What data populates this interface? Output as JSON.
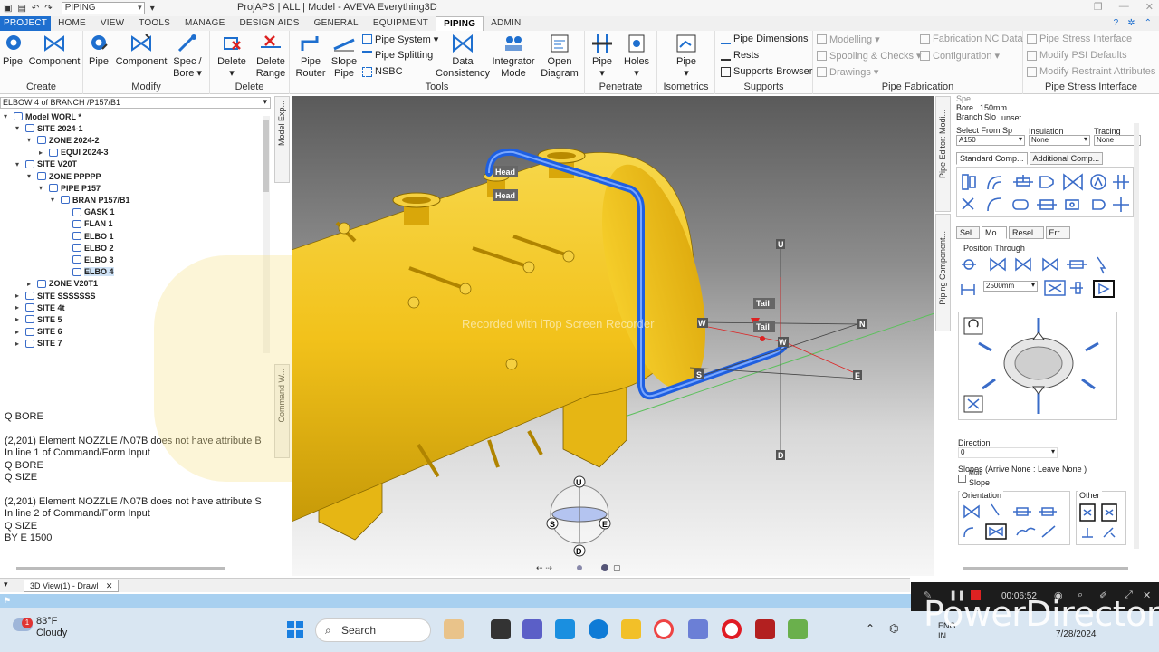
{
  "titlebar": {
    "module_combo": "PIPING",
    "title": "ProjAPS | ALL | Model - AVEVA Everything3D"
  },
  "menu": {
    "tabs": [
      "PROJECT",
      "HOME",
      "VIEW",
      "TOOLS",
      "MANAGE",
      "DESIGN AIDS",
      "GENERAL",
      "EQUIPMENT",
      "PIPING",
      "ADMIN"
    ]
  },
  "ribbon": {
    "create": {
      "title": "Create",
      "pipe": "Pipe",
      "component": "Component"
    },
    "modify": {
      "title": "Modify",
      "pipe": "Pipe",
      "component": "Component",
      "spec": "Spec /",
      "bore": "Bore"
    },
    "delete": {
      "title": "Delete",
      "delete": "Delete",
      "delete_range_1": "Delete",
      "delete_range_2": "Range"
    },
    "tools": {
      "title": "Tools",
      "pipe_router_1": "Pipe",
      "pipe_router_2": "Router",
      "slope_1": "Slope",
      "slope_2": "Pipe",
      "pipe_system": "Pipe System",
      "pipe_splitting": "Pipe Splitting",
      "nsbc": "NSBC",
      "data_1": "Data",
      "data_2": "Consistency",
      "integrator_1": "Integrator",
      "integrator_2": "Mode",
      "open_1": "Open",
      "open_2": "Diagram"
    },
    "penetrate": {
      "title": "Penetrate",
      "pipe": "Pipe",
      "holes": "Holes"
    },
    "isometrics": {
      "title": "Isometrics",
      "pipe": "Pipe"
    },
    "supports": {
      "title": "Supports",
      "pipe_dimensions": "Pipe Dimensions",
      "rests": "Rests",
      "supports_browser": "Supports Browser"
    },
    "pipe_fabrication": {
      "title": "Pipe Fabrication",
      "modelling": "Modelling",
      "spooling": "Spooling & Checks",
      "drawings": "Drawings",
      "fab_nc": "Fabrication NC Data",
      "configuration": "Configuration"
    },
    "stress": {
      "title": "Pipe Stress Interface",
      "psi": "Pipe Stress Interface",
      "modify_psi": "Modify PSI Defaults",
      "modify_restraint": "Modify Restraint Attributes"
    }
  },
  "explorer": {
    "current": "ELBOW 4 of BRANCH /P157/B1",
    "tab_label": "Model Exp...",
    "tree": [
      {
        "label": "Model WORL *",
        "indent": 0,
        "exp": "▾",
        "sel": false
      },
      {
        "label": "SITE 2024-1",
        "indent": 1,
        "exp": "▾",
        "sel": false
      },
      {
        "label": "ZONE 2024-2",
        "indent": 2,
        "exp": "▾",
        "sel": false
      },
      {
        "label": "EQUI 2024-3",
        "indent": 3,
        "exp": "▸",
        "sel": false
      },
      {
        "label": "SITE V20T",
        "indent": 1,
        "exp": "▾",
        "sel": false
      },
      {
        "label": "ZONE PPPPP",
        "indent": 2,
        "exp": "▾",
        "sel": false
      },
      {
        "label": "PIPE P157",
        "indent": 3,
        "exp": "▾",
        "sel": false
      },
      {
        "label": "BRAN P157/B1",
        "indent": 4,
        "exp": "▾",
        "sel": false
      },
      {
        "label": "GASK 1",
        "indent": 5,
        "exp": "",
        "sel": false
      },
      {
        "label": "FLAN 1",
        "indent": 5,
        "exp": "",
        "sel": false
      },
      {
        "label": "ELBO 1",
        "indent": 5,
        "exp": "",
        "sel": false
      },
      {
        "label": "ELBO 2",
        "indent": 5,
        "exp": "",
        "sel": false
      },
      {
        "label": "ELBO 3",
        "indent": 5,
        "exp": "",
        "sel": false
      },
      {
        "label": "ELBO 4",
        "indent": 5,
        "exp": "",
        "sel": true
      },
      {
        "label": "ZONE V20T1",
        "indent": 2,
        "exp": "▸",
        "sel": false
      },
      {
        "label": "SITE SSSSSSS",
        "indent": 1,
        "exp": "▸",
        "sel": false
      },
      {
        "label": "SITE 4t",
        "indent": 1,
        "exp": "▸",
        "sel": false
      },
      {
        "label": "SITE 5",
        "indent": 1,
        "exp": "▸",
        "sel": false
      },
      {
        "label": "SITE 6",
        "indent": 1,
        "exp": "▸",
        "sel": false
      },
      {
        "label": "SITE 7",
        "indent": 1,
        "exp": "▸",
        "sel": false
      }
    ]
  },
  "command": {
    "tab_label": "Command W...",
    "lines": [
      "Q BORE",
      "",
      "(2,201)   Element NOZZLE /N07B does not have attribute B",
      " In line 1 of Command/Form Input",
      "Q BORE",
      "Q SIZE",
      "",
      "(2,201)   Element NOZZLE /N07B does not have attribute S",
      " In line 2 of Command/Form Input",
      "Q SIZE",
      "BY E 1500"
    ]
  },
  "viewport": {
    "labels": {
      "head1": "Head",
      "head2": "Head",
      "tail1": "Tail",
      "tail2": "Tail",
      "u": "U",
      "d": "D",
      "n": "N",
      "s": "S",
      "e": "E",
      "w1": "W",
      "w2": "W"
    },
    "compass": {
      "u": "U",
      "d": "D",
      "s": "S",
      "e": "E"
    },
    "watermark": "Recorded with iTop Screen Recorder"
  },
  "editor": {
    "side_tab_1": "Pipe Editor: Modi...",
    "side_tab_2": "Piping Component...",
    "spec_label": "Spe",
    "bore_label": "Bore",
    "bore_value": "150mm",
    "branch_label": "Branch Slo",
    "branch_value": "unset",
    "select_from_spec_label": "Select From Sp",
    "insulation_label": "Insulation",
    "tracing_label": "Tracing",
    "spec_value": "A150",
    "insulation_value": "None",
    "tracing_value": "None",
    "tab_standard": "Standard Comp...",
    "tab_additional": "Additional Comp...",
    "mode_tabs": [
      "Sel..",
      "Mo...",
      "Resel...",
      "Err..."
    ],
    "position_through": "Position Through",
    "distance_value": "2500mm",
    "direction_label": "Direction",
    "direction_value": "0",
    "slopes_label": "Slopes (Arrive None : Leave None )",
    "multi_slope_1": "Multi",
    "multi_slope_2": "Slope",
    "orientation_label": "Orientation",
    "other_label": "Other"
  },
  "docbar": {
    "tab": "3D View(1) - Drawl"
  },
  "taskbar": {
    "temp": "83°F",
    "weather": "Cloudy",
    "search_placeholder": "Search",
    "lang_1": "ENG",
    "lang_2": "IN",
    "date": "7/28/2024"
  },
  "recorder": {
    "timer": "00:06:52",
    "brand": "PowerDirector"
  },
  "colors": {
    "accent": "#1e6fcf",
    "vessel": "#f2c21b",
    "pipe": "#1f5fe0",
    "taskbar": "#d9e6f2"
  }
}
